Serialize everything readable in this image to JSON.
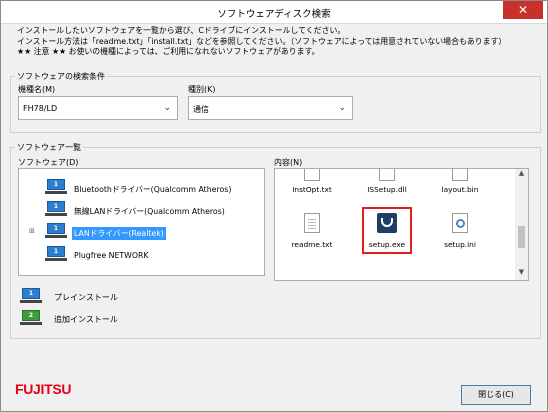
{
  "window": {
    "title": "ソフトウェアディスク検索",
    "close_glyph": "✕"
  },
  "description": [
    "インストールしたいソフトウェアを一覧から選び、Cドライブにインストールしてください。",
    "インストール方法は「readme.txt」「install.txt」などを参照してください。（ソフトウェアによっては用意されていない場合もあります）",
    "★★ 注意 ★★ お使いの機種によっては、ご利用になれないソフトウェアがあります。"
  ],
  "search": {
    "group_label": "ソフトウェアの検索条件",
    "model_label": "機種名(M)",
    "model_value": "FH78/LD",
    "type_label": "種別(K)",
    "type_value": "通信"
  },
  "software_list": {
    "group_label": "ソフトウェア一覧",
    "tree_label": "ソフトウェア(D)",
    "items": [
      {
        "label": "Bluetoothドライバー(Qualcomm Atheros)",
        "badge": "1"
      },
      {
        "label": "無線LANドライバー(Qualcomm Atheros)",
        "badge": "1"
      },
      {
        "label": "LANドライバー(Realtek)",
        "badge": "1"
      },
      {
        "label": "Plugfree NETWORK",
        "badge": "1"
      }
    ],
    "expander_glyph": "⊞",
    "content_label": "内容(N)",
    "files": [
      {
        "name": "InstOpt.txt",
        "icon": "text-file-icon"
      },
      {
        "name": "ISSetup.dll",
        "icon": "dll-file-icon"
      },
      {
        "name": "layout.bin",
        "icon": "bin-file-icon"
      },
      {
        "name": "readme.txt",
        "icon": "text-file-icon"
      },
      {
        "name": "setup.exe",
        "icon": "setup-exe-icon"
      },
      {
        "name": "setup.ini",
        "icon": "ini-file-icon"
      }
    ]
  },
  "legend": [
    {
      "badge": "1",
      "label": "プレインストール",
      "color": "#2b7fd0"
    },
    {
      "badge": "2",
      "label": "追加インストール",
      "color": "#3e9e3e"
    }
  ],
  "brand": {
    "logo_text": "FUJITSU",
    "color": "#e60012"
  },
  "buttons": {
    "close_label": "閉じる(C)"
  }
}
